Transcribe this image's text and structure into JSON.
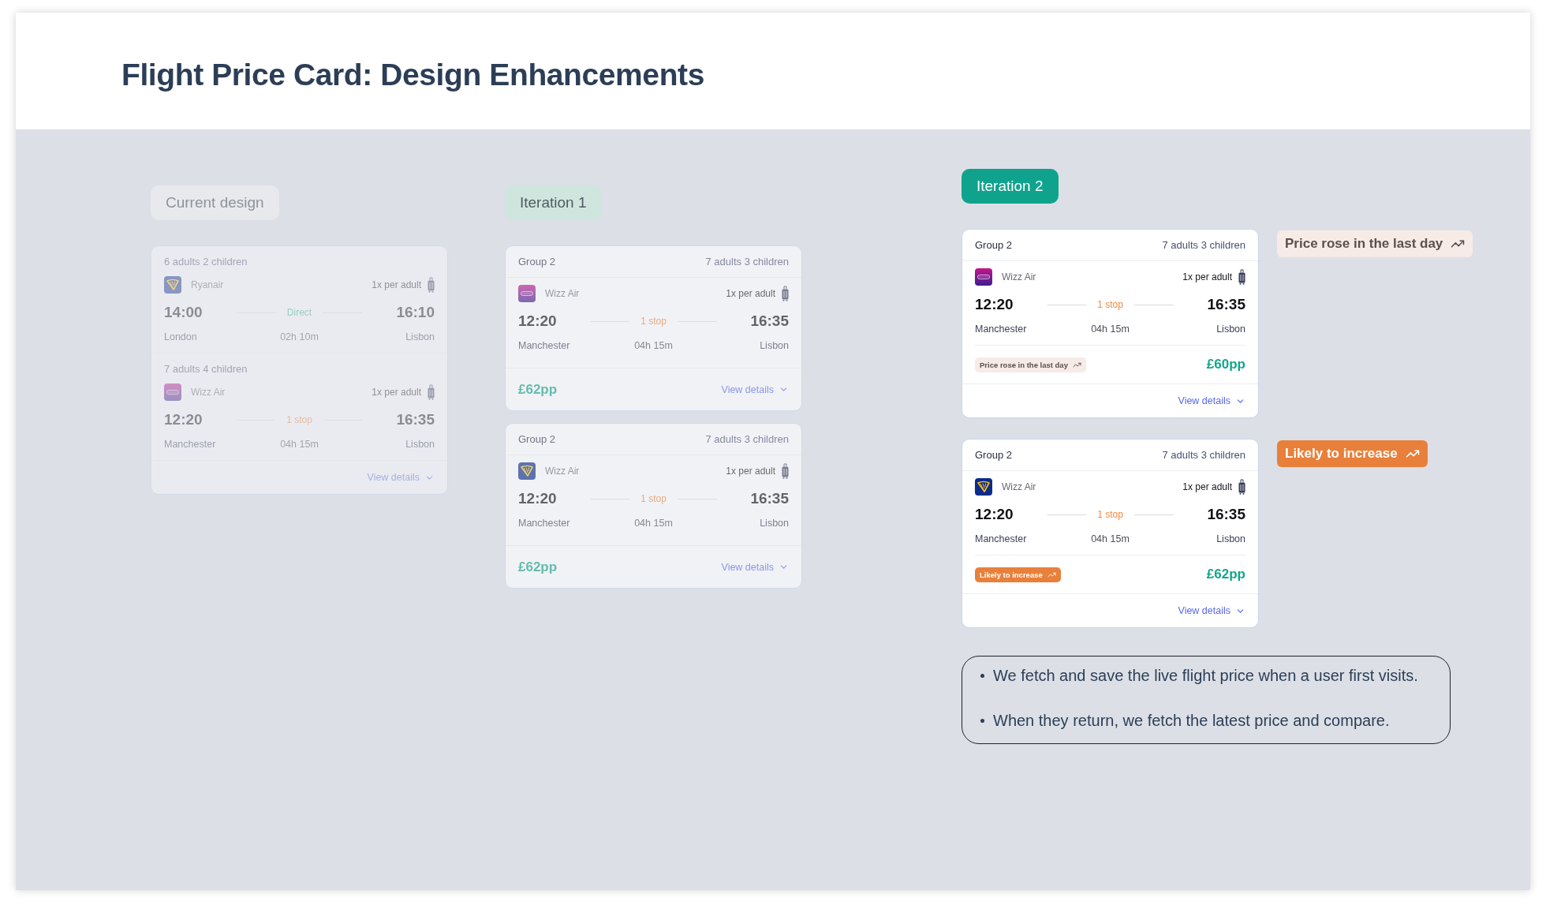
{
  "title": "Flight Price Card: Design Enhancements",
  "columns": [
    {
      "label": {
        "text": "Current design",
        "color": "#e7e9ed"
      },
      "kind": "faint",
      "cards": [
        {
          "itineraries": [
            {
              "passengers": "6 adults 2 children",
              "logo": {
                "kind": "harp"
              },
              "airline": "Ryanair",
              "baggage": "1x per adult",
              "depart_time": "14:00",
              "stop": {
                "label": "Direct",
                "kind": "direct"
              },
              "arrive_time": "16:10",
              "origin": "London",
              "duration": "02h 10m",
              "destination": "Lisbon"
            },
            {
              "passengers": "7 adults 4 children",
              "logo": {
                "kind": "wordmark"
              },
              "airline": "Wizz Air",
              "baggage": "1x per adult",
              "depart_time": "12:20",
              "stop": {
                "label": "1 stop",
                "kind": "stopover"
              },
              "arrive_time": "16:35",
              "origin": "Manchester",
              "duration": "04h 15m",
              "destination": "Lisbon"
            }
          ],
          "footer": {
            "link": "View details"
          }
        }
      ]
    },
    {
      "label": {
        "text": "Iteration 1",
        "color": "#cfe6df"
      },
      "kind": "muted",
      "cards": [
        {
          "header": {
            "group": "Group 2",
            "passengers": "7 adults 3 children"
          },
          "itineraries": [
            {
              "logo": {
                "kind": "wordmark"
              },
              "airline": "Wizz Air",
              "baggage": "1x per adult",
              "depart_time": "12:20",
              "stop": {
                "label": "1 stop",
                "kind": "stopover"
              },
              "arrive_time": "16:35",
              "origin": "Manchester",
              "duration": "04h 15m",
              "destination": "Lisbon"
            }
          ],
          "footer": {
            "price": "£62pp",
            "link": "View details"
          }
        },
        {
          "header": {
            "group": "Group 2",
            "passengers": "7 adults 3 children"
          },
          "itineraries": [
            {
              "logo": {
                "kind": "harp"
              },
              "airline": "Wizz Air",
              "baggage": "1x per adult",
              "depart_time": "12:20",
              "stop": {
                "label": "1 stop",
                "kind": "stopover"
              },
              "arrive_time": "16:35",
              "origin": "Manchester",
              "duration": "04h 15m",
              "destination": "Lisbon"
            }
          ],
          "footer": {
            "price": "£62pp",
            "link": "View details"
          }
        }
      ]
    },
    {
      "label": {
        "text": "Iteration 2",
        "color": "#0fa38e"
      },
      "kind": "full",
      "cards": [
        {
          "header": {
            "group": "Group 2",
            "passengers": "7 adults 3 children"
          },
          "itineraries": [
            {
              "logo": {
                "kind": "wordmark"
              },
              "airline": "Wizz Air",
              "baggage": "1x per adult",
              "depart_time": "12:20",
              "stop": {
                "label": "1 stop",
                "kind": "stopover"
              },
              "arrive_time": "16:35",
              "origin": "Manchester",
              "duration": "04h 15m",
              "destination": "Lisbon"
            }
          ],
          "price_row": {
            "badge": {
              "text": "Price rose in the last day",
              "kind": "subtle"
            },
            "price": "£60pp"
          },
          "footer": {
            "link": "View details"
          },
          "callout": {
            "text": "Price rose in the last day",
            "kind": "subtle"
          }
        },
        {
          "header": {
            "group": "Group 2",
            "passengers": "7 adults 3 children"
          },
          "itineraries": [
            {
              "logo": {
                "kind": "harp"
              },
              "airline": "Wizz Air",
              "baggage": "1x per adult",
              "depart_time": "12:20",
              "stop": {
                "label": "1 stop",
                "kind": "stopover"
              },
              "arrive_time": "16:35",
              "origin": "Manchester",
              "duration": "04h 15m",
              "destination": "Lisbon"
            }
          ],
          "price_row": {
            "badge": {
              "text": "Likely to increase",
              "kind": "strong"
            },
            "price": "£62pp"
          },
          "footer": {
            "link": "View details"
          },
          "callout": {
            "text": "Likely to increase",
            "kind": "strong"
          }
        }
      ],
      "notes": [
        "We fetch and save the live flight price when a user first visits.",
        "When they return, we fetch the latest price and compare."
      ]
    }
  ]
}
